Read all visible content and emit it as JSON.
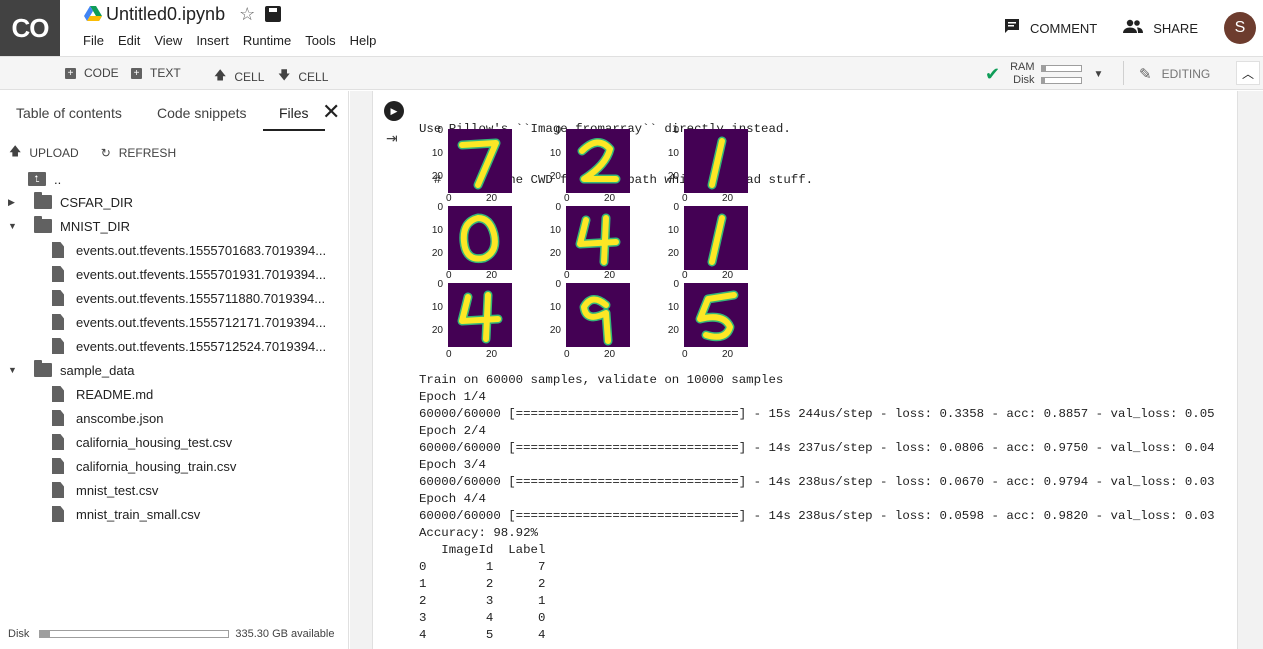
{
  "app": {
    "logo": "CO",
    "notebook_title": "Untitled0.ipynb"
  },
  "menu": [
    "File",
    "Edit",
    "View",
    "Insert",
    "Runtime",
    "Tools",
    "Help"
  ],
  "header_actions": {
    "comment": "COMMENT",
    "share": "SHARE",
    "avatar_letter": "S"
  },
  "toolbar": {
    "add_code": "CODE",
    "add_text": "TEXT",
    "cell_up": "CELL",
    "cell_down": "CELL",
    "ram_label": "RAM",
    "disk_label": "Disk",
    "ram_usage": 0.12,
    "disk_usage": 0.08,
    "editing": "EDITING"
  },
  "sidebar": {
    "tabs": [
      "Table of contents",
      "Code snippets",
      "Files"
    ],
    "active_tab": "Files",
    "upload": "UPLOAD",
    "refresh": "REFRESH",
    "tree": [
      {
        "label": "..",
        "kind": "up",
        "depth": 0
      },
      {
        "label": "CSFAR_DIR",
        "kind": "folder",
        "expanded": false,
        "depth": 0
      },
      {
        "label": "MNIST_DIR",
        "kind": "folder",
        "expanded": true,
        "depth": 0
      },
      {
        "label": "events.out.tfevents.1555701683.7019394...",
        "kind": "file",
        "depth": 1
      },
      {
        "label": "events.out.tfevents.1555701931.7019394...",
        "kind": "file",
        "depth": 1
      },
      {
        "label": "events.out.tfevents.1555711880.7019394...",
        "kind": "file",
        "depth": 1
      },
      {
        "label": "events.out.tfevents.1555712171.7019394...",
        "kind": "file",
        "depth": 1
      },
      {
        "label": "events.out.tfevents.1555712524.7019394...",
        "kind": "file",
        "depth": 1
      },
      {
        "label": "sample_data",
        "kind": "folder",
        "expanded": true,
        "depth": 0
      },
      {
        "label": "README.md",
        "kind": "file",
        "depth": 1
      },
      {
        "label": "anscombe.json",
        "kind": "file",
        "depth": 1
      },
      {
        "label": "california_housing_test.csv",
        "kind": "file",
        "depth": 1
      },
      {
        "label": "california_housing_train.csv",
        "kind": "file",
        "depth": 1
      },
      {
        "label": "mnist_test.csv",
        "kind": "file",
        "depth": 1
      },
      {
        "label": "mnist_train_small.csv",
        "kind": "file",
        "depth": 1
      }
    ],
    "disk_label": "Disk",
    "disk_usage": 0.05,
    "disk_available": "335.30 GB available"
  },
  "output": {
    "warning_lines": [
      "Use Pillow's ``Image.fromarray`` directly instead.",
      "  # Remove the CWD from sys.path while we load stuff."
    ],
    "digit_panels": {
      "labels": [
        "7",
        "2",
        "1",
        "0",
        "4",
        "1",
        "4",
        "9",
        "5"
      ],
      "y_ticks": [
        "0",
        "10",
        "20"
      ],
      "x_ticks": [
        "0",
        "20"
      ],
      "colors": {
        "background": "#440154",
        "stroke": "#fde725",
        "edge": "#35b779"
      }
    },
    "training_lines": [
      "Train on 60000 samples, validate on 10000 samples",
      "Epoch 1/4",
      "60000/60000 [==============================] - 15s 244us/step - loss: 0.3358 - acc: 0.8857 - val_loss: 0.05",
      "Epoch 2/4",
      "60000/60000 [==============================] - 14s 237us/step - loss: 0.0806 - acc: 0.9750 - val_loss: 0.04",
      "Epoch 3/4",
      "60000/60000 [==============================] - 14s 238us/step - loss: 0.0670 - acc: 0.9794 - val_loss: 0.03",
      "Epoch 4/4",
      "60000/60000 [==============================] - 14s 238us/step - loss: 0.0598 - acc: 0.9820 - val_loss: 0.03",
      "Accuracy: 98.92%",
      "   ImageId  Label",
      "0        1      7",
      "1        2      2",
      "2        3      1",
      "3        4      0",
      "4        5      4"
    ]
  }
}
